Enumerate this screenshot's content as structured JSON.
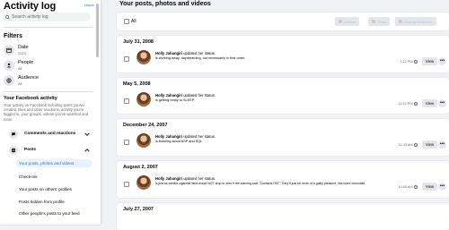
{
  "sidebar": {
    "title": "Activity log",
    "link": "Home",
    "search_placeholder": "Search activity log",
    "filters_heading": "Filters",
    "filters": [
      {
        "label": "Date",
        "sub": "2023",
        "icon": "calendar-icon"
      },
      {
        "label": "People",
        "sub": "All",
        "icon": "people-icon"
      },
      {
        "label": "Audience",
        "sub": "All",
        "icon": "globe-icon"
      }
    ],
    "activity_heading": "Your Facebook activity",
    "activity_desc": "Your activity on Facebook including posts you've created, likes and other reactions, activity you're tagged in, your groups, videos you've watched and more",
    "categories": [
      {
        "label": "Comments and reactions",
        "icon": "comment-icon"
      },
      {
        "label": "Posts",
        "icon": "posts-icon"
      }
    ],
    "sub_items": [
      "Your posts, photos and videos",
      "Check-ins",
      "Your posts on others' profiles",
      "Posts hidden from profile",
      "Other people's posts to your feed"
    ]
  },
  "main": {
    "title": "Your posts, photos and videos",
    "toolbar": {
      "all_label": "All",
      "archive": "Archive",
      "trash": "Trash",
      "change_audience": "Change Audience"
    },
    "entries": [
      {
        "date": "July 31, 2008",
        "name": "Holly Jahangiri",
        "action": "updated her status.",
        "text": "is working away, daydreaming, not necessarily in that order.",
        "time": "1:22 PM"
      },
      {
        "date": "May 5, 2008",
        "name": "Holly Jahangiri",
        "action": "updated her status.",
        "text": "is getting ready to SLEEP.",
        "time": "11:10 PM"
      },
      {
        "date": "December 24, 2007",
        "name": "Holly Jahangiri",
        "action": "updated her status.",
        "text": "is learning about ASP and SQL",
        "time": "11:43 AM"
      },
      {
        "date": "August 2, 2007",
        "name": "Holly Jahangiri",
        "action": "updated her status.",
        "text": "is just as certain cigarette tabs would NOT drop to zero if the warning said \"Contains PAT.\" They'd just be more of a guilty pleasure, like burnt chocolate.",
        "time": "10:40 AM"
      },
      {
        "date": "July 27, 2007",
        "name": "",
        "action": "",
        "text": "",
        "time": ""
      }
    ],
    "view_label": "View",
    "more_label": "•••"
  },
  "colors": {
    "accent": "#1b74e4",
    "page_bg": "#f0f2f5",
    "button_bg": "#e4e6eb",
    "muted_text": "#65676b"
  }
}
